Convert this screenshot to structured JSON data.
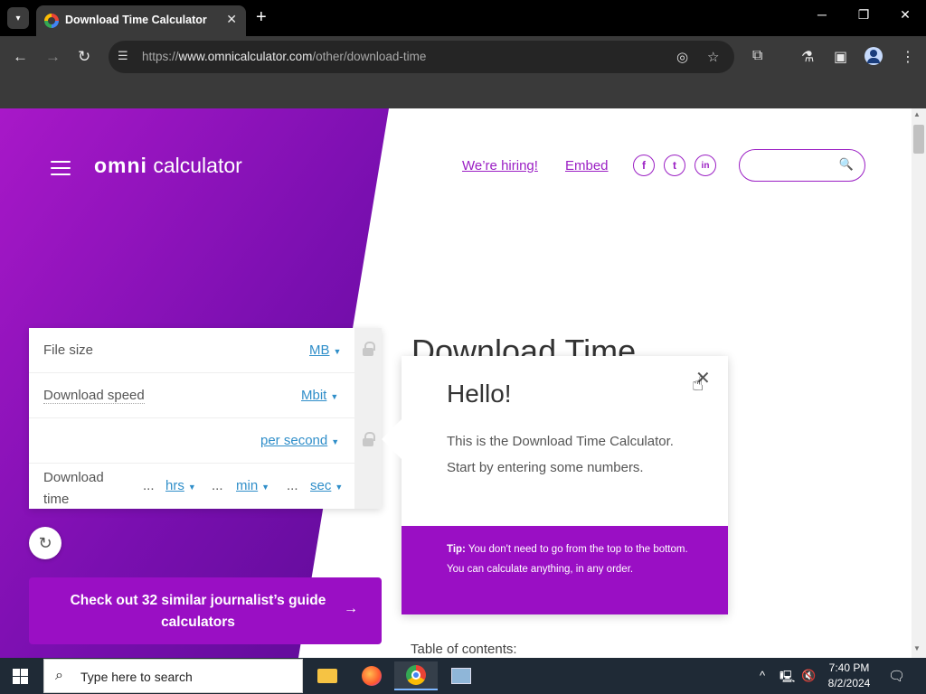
{
  "browser": {
    "tab_title": "Download Time Calculator",
    "tab_close": "✕",
    "new_tab": "+",
    "url_prefix": "https://",
    "url_domain": "www.omnicalculator.com",
    "url_path": "/other/download-time"
  },
  "header": {
    "logo_omni": "omni",
    "logo_calc": " calculator",
    "hiring_link": "We’re hiring!",
    "embed_link": "Embed",
    "social": [
      "f",
      "t",
      "in"
    ],
    "search_placeholder": ""
  },
  "page": {
    "heading": "Download Time",
    "toc": "Table of contents:"
  },
  "calculator": {
    "rows": [
      {
        "label": "File size",
        "unit": "MB"
      },
      {
        "label": "Download speed",
        "unit": "Mbit"
      },
      {
        "label": "",
        "unit": "per second"
      },
      {
        "label": "Download time",
        "units": [
          "hrs",
          "min",
          "sec"
        ],
        "values": [
          "...",
          "...",
          "..."
        ]
      }
    ],
    "similar_button": "Check out 32 similar journalist’s guide calculators",
    "similar_arrow": "→"
  },
  "tooltip": {
    "title": "Hello!",
    "body": "This is the Download Time Calculator. Start by entering some numbers.",
    "tip_label": "Tip:",
    "tip_text": " You don't need to go from the top to the bottom.",
    "tip_line2": "You can calculate anything, in any order.",
    "close": "✕"
  },
  "taskbar": {
    "search_placeholder": "Type here to search",
    "time": "7:40 PM",
    "date": "8/2/2024"
  },
  "colors": {
    "brand_purple": "#9a0fc4",
    "link_blue": "#2f8ec9"
  }
}
